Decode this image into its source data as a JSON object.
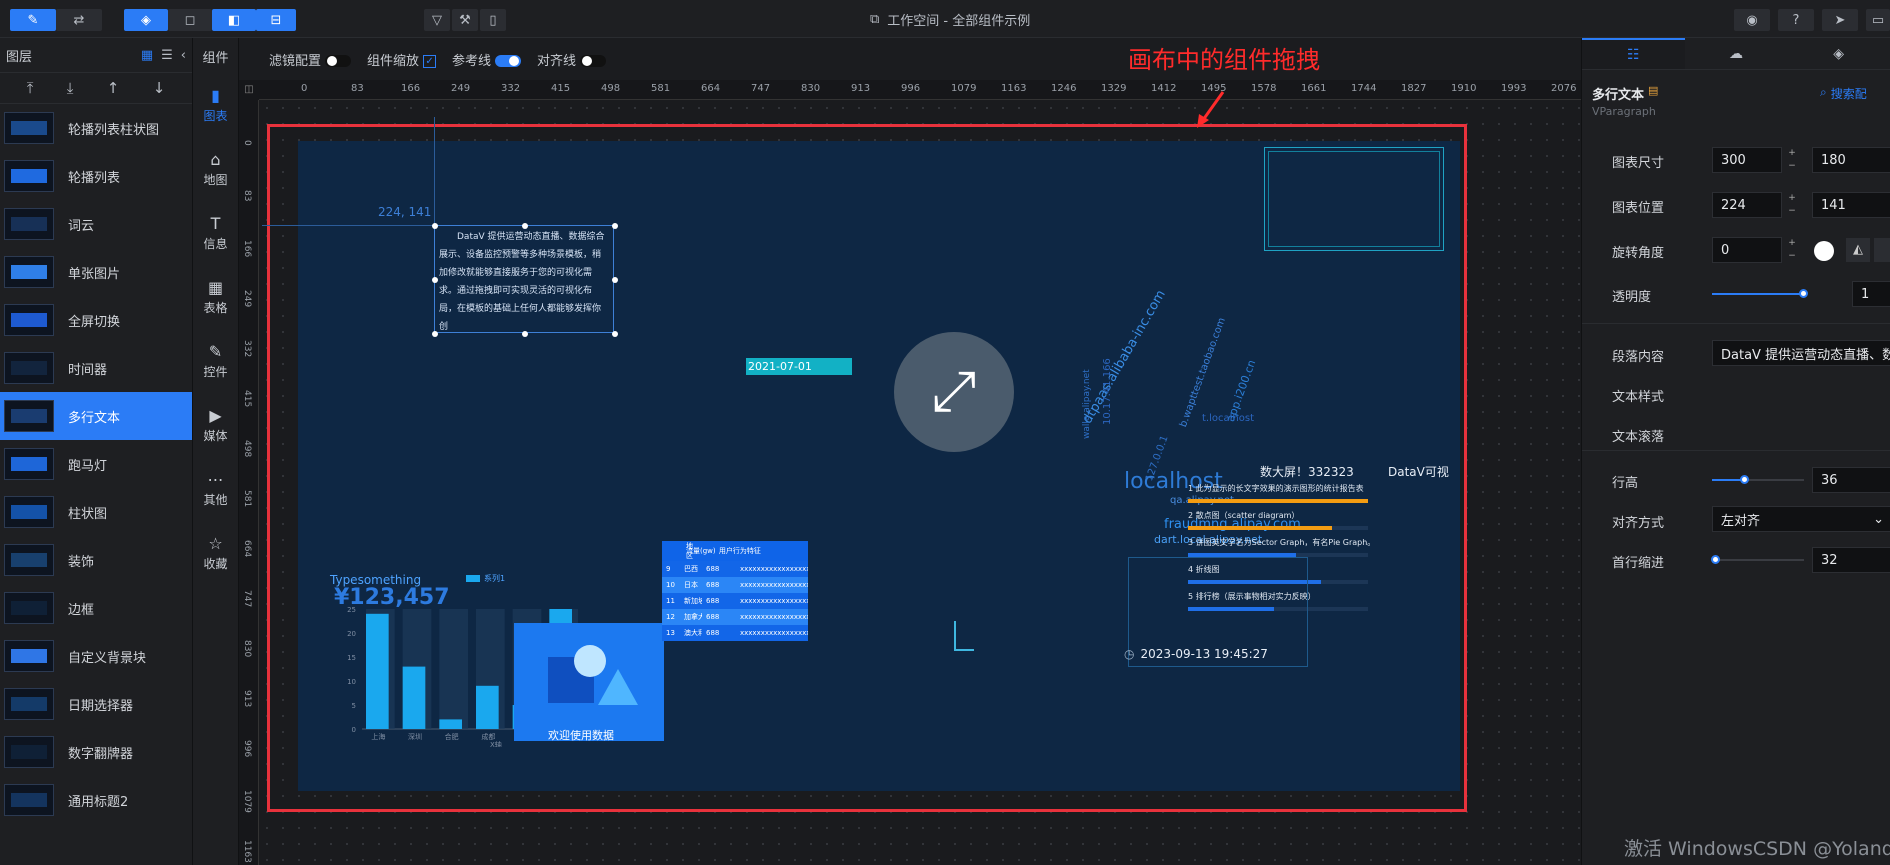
{
  "toolbar": {
    "title": "工作空间 - 全部组件示例"
  },
  "layers": {
    "header": "图层",
    "items": [
      {
        "label": "轮播列表柱状图"
      },
      {
        "label": "轮播列表"
      },
      {
        "label": "词云"
      },
      {
        "label": "单张图片"
      },
      {
        "label": "全屏切换"
      },
      {
        "label": "时间器"
      },
      {
        "label": "多行文本",
        "active": true
      },
      {
        "label": "跑马灯"
      },
      {
        "label": "柱状图"
      },
      {
        "label": "装饰"
      },
      {
        "label": "边框"
      },
      {
        "label": "自定义背景块"
      },
      {
        "label": "日期选择器"
      },
      {
        "label": "数字翻牌器"
      },
      {
        "label": "通用标题2"
      }
    ]
  },
  "components": {
    "header": "组件",
    "tabs": [
      {
        "label": "图表",
        "icon": "chart-icon",
        "active": true
      },
      {
        "label": "地图",
        "icon": "map-icon"
      },
      {
        "label": "信息",
        "icon": "text-icon"
      },
      {
        "label": "表格",
        "icon": "table-icon"
      },
      {
        "label": "控件",
        "icon": "control-icon"
      },
      {
        "label": "媒体",
        "icon": "media-icon"
      },
      {
        "label": "其他",
        "icon": "other-icon"
      },
      {
        "label": "收藏",
        "icon": "star-icon"
      }
    ]
  },
  "config": {
    "filter": "滤镜配置",
    "scale": "组件缩放",
    "ref": "参考线",
    "align": "对齐线"
  },
  "annotation": "画布中的组件拖拽",
  "ruler": {
    "h": [
      "0",
      "83",
      "166",
      "249",
      "332",
      "415",
      "498",
      "581",
      "664",
      "747",
      "830",
      "913",
      "996",
      "1079",
      "1163",
      "1246",
      "1329",
      "1412",
      "1495",
      "1578",
      "1661",
      "1744",
      "1827",
      "1910",
      "1993",
      "2076"
    ],
    "v": [
      "0",
      "83",
      "166",
      "249",
      "332",
      "415",
      "498",
      "581",
      "664",
      "747",
      "830",
      "913",
      "996",
      "1079",
      "1163"
    ]
  },
  "screen": {
    "coord": "224, 141",
    "paragraph": "DataV 提供运营动态直播、数据综合展示、设备监控预警等多种场景模板，稍加修改就能够直接服务于您的可视化需求。通过拖拽即可实现灵活的可视化布局，在模板的基础上任何人都能够发挥你创",
    "date": "2021-07-01",
    "marquee": "欢迎使用数据",
    "wordcloud": [
      "localhost",
      "dtpaas.alibaba-inc.com",
      "fraudmng.alipay.com",
      "dart.local.alipay.net",
      "qa.alipay.net",
      "app.i200.cn",
      "b.wapttest.taobao.com",
      "127.0.0.1",
      "t.localhost",
      "10.17.41.166",
      "walle.alipay.net"
    ],
    "rank_title": "数大屏！332323",
    "rank_right": "DataV可视",
    "rank_items": [
      {
        "label": "1  此为显示的长文字效果的演示图形的统计报告表",
        "pct": 100
      },
      {
        "label": "2  散点图（scatter diagram）",
        "pct": 80
      },
      {
        "label": "3  饼图英文学名为Sector Graph，有名Pie Graph。",
        "pct": 60
      },
      {
        "label": "4  折线图",
        "pct": 74
      },
      {
        "label": "5  排行榜（展示事物相对实力反映）",
        "pct": 48
      }
    ],
    "clock": "2023-09-13 19:45:27",
    "bar_title": "Typesomething",
    "bar_legend": "系列1",
    "flip_number": "¥123,457",
    "table_headers": [
      "地区",
      "流量(gw)",
      "用户行为特征"
    ],
    "table_rows": [
      [
        "9",
        "巴西",
        "688",
        "xxxxxxxxxxxxxxxxxx"
      ],
      [
        "10",
        "日本",
        "688",
        "xxxxxxxxxxxxxxxxxx"
      ],
      [
        "11",
        "新加坡",
        "688",
        "xxxxxxxxxxxxxxxxxx"
      ],
      [
        "12",
        "加拿大",
        "688",
        "xxxxxxxxxxxxxxxxxx"
      ],
      [
        "13",
        "澳大利亚",
        "688",
        "xxxxxxxxxxxxxxxxxx"
      ]
    ]
  },
  "chart_data": {
    "type": "bar",
    "categories": [
      "上海",
      "深圳",
      "合肥",
      "成都",
      "安徽",
      "北京"
    ],
    "values": [
      24,
      13,
      2,
      9,
      5,
      26
    ],
    "ylim": [
      0,
      25
    ],
    "yticks": [
      "0",
      "5",
      "10",
      "15",
      "20",
      "25"
    ],
    "xlabel": "X轴",
    "legend": "系列1"
  },
  "props": {
    "title": "多行文本",
    "subtitle": "VParagraph",
    "search": "搜索配",
    "size_label": "图表尺寸",
    "size_w": "300",
    "size_h": "180",
    "pos_label": "图表位置",
    "pos_x": "224",
    "pos_y": "141",
    "rotate_label": "旋转角度",
    "rotate": "0",
    "opacity_label": "透明度",
    "opacity": "1",
    "opacity_level": 1,
    "content_label": "段落内容",
    "content": "DataV 提供运营动态直播、数据",
    "style_label": "文本样式",
    "scroll_label": "文本滚落",
    "lineheight_label": "行高",
    "lineheight": "36",
    "lineheight_level": 0.36,
    "align_label": "对齐方式",
    "align": "左对齐",
    "indent_label": "首行缩进",
    "indent": "32",
    "indent_level": 0.04
  },
  "watermark": "激活 WindowsCSDN @Yolanda_2022"
}
